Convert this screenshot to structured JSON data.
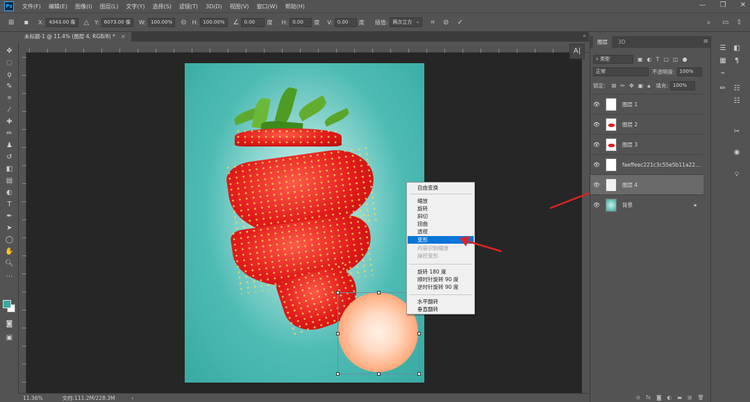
{
  "menubar": {
    "logo": "Ps",
    "items": [
      "文件(F)",
      "编辑(E)",
      "图像(I)",
      "图层(L)",
      "文字(Y)",
      "选择(S)",
      "滤镜(T)",
      "3D(D)",
      "视图(V)",
      "窗口(W)",
      "帮助(H)"
    ]
  },
  "options": {
    "x_label": "X:",
    "x_value": "4343.00 像",
    "y_label": "Y:",
    "y_value": "6073.00 像",
    "w_label": "W:",
    "w_value": "100.00%",
    "h_label": "H:",
    "h_value": "100.00%",
    "angle_value": "0.00",
    "angle_unit": "度",
    "hskew_label": "H:",
    "hskew_value": "0.00",
    "hskew_unit": "度",
    "vskew_label": "V:",
    "vskew_value": "0.00",
    "vskew_unit": "度",
    "interp_label": "插值:",
    "interp_value": "两次立方"
  },
  "document_tab": {
    "title": "未标题-1 @ 11.4% (图层 4, RGB/8) *",
    "close": "×"
  },
  "context_menu": {
    "items": [
      {
        "label": "自由变换",
        "state": "normal"
      },
      {
        "label": "缩放",
        "state": "normal"
      },
      {
        "label": "旋转",
        "state": "normal"
      },
      {
        "label": "斜切",
        "state": "normal"
      },
      {
        "label": "扭曲",
        "state": "normal"
      },
      {
        "label": "透视",
        "state": "normal"
      },
      {
        "label": "变形",
        "state": "highlighted"
      },
      {
        "label": "内容识别缩放",
        "state": "disabled"
      },
      {
        "label": "操控变形",
        "state": "disabled"
      },
      {
        "label": "旋转 180 度",
        "state": "normal"
      },
      {
        "label": "顺时针旋转 90 度",
        "state": "normal"
      },
      {
        "label": "逆时针旋转 90 度",
        "state": "normal"
      },
      {
        "label": "水平翻转",
        "state": "normal"
      },
      {
        "label": "垂直翻转",
        "state": "normal"
      }
    ]
  },
  "layers_panel": {
    "tab_layers": "图层",
    "tab_3d": "3D",
    "filter_kind": "类型",
    "blend_mode": "正常",
    "opacity_label": "不透明度:",
    "opacity_value": "100%",
    "lock_label": "锁定:",
    "fill_label": "填充:",
    "fill_value": "100%",
    "layers": [
      {
        "name": "图层 1",
        "selected": false,
        "thumb": "white"
      },
      {
        "name": "图层 2",
        "selected": false,
        "thumb": "red"
      },
      {
        "name": "图层 3",
        "selected": false,
        "thumb": "red"
      },
      {
        "name": "faeffeec221c3c55e5b11a22...",
        "selected": false,
        "thumb": "white"
      },
      {
        "name": "图层 4",
        "selected": true,
        "thumb": "white"
      },
      {
        "name": "背景",
        "selected": false,
        "thumb": "teal",
        "locked": true
      }
    ],
    "bottom_icons": [
      "link-icon",
      "fx",
      "mask-icon",
      "adjustment-icon",
      "folder-icon",
      "new-layer-icon",
      "trash-icon"
    ]
  },
  "statusbar": {
    "zoom": "11.36%",
    "doc_info": "文档:111.2M/228.3M"
  },
  "colors": {
    "foreground": "#3aa9a3",
    "background": "#ffffff",
    "highlight": "#0b74d8",
    "arrow": "#e02222"
  }
}
